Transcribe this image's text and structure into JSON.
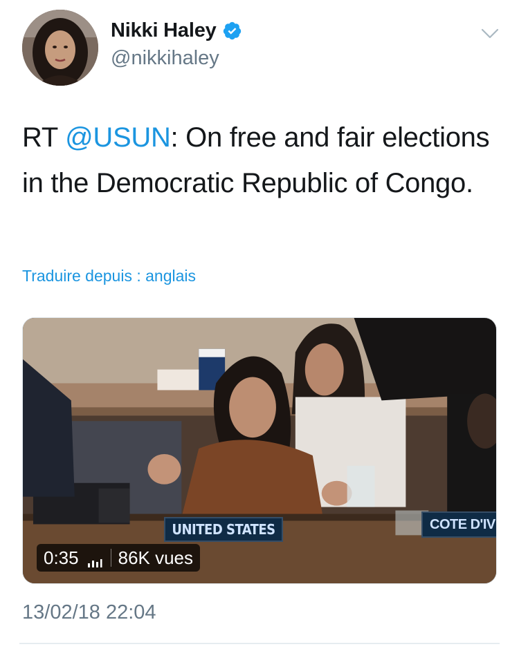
{
  "tweet": {
    "author": {
      "display_name": "Nikki Haley",
      "handle": "@nikkihaley",
      "verified": true,
      "verified_icon": "verified-badge-icon",
      "avatar_icon": "profile-photo"
    },
    "menu_icon": "chevron-down-icon",
    "text": {
      "prefix": "RT ",
      "mention": "@USUN",
      "body": ": On free and fair elections in the Democratic Republic of Congo."
    },
    "translate_label": "Traduire depuis : anglais",
    "media": {
      "type": "video",
      "duration": "0:35",
      "views": "86K vues",
      "nameplates": [
        "UNITED STATES",
        "COTE D'IV"
      ]
    },
    "timestamp": "13/02/18 22:04"
  },
  "colors": {
    "accent": "#1b95e0",
    "text_primary": "#14171a",
    "text_secondary": "#657786"
  }
}
